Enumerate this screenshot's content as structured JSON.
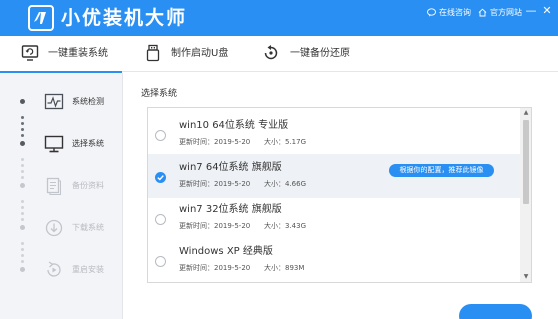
{
  "app": {
    "title": "小优装机大师",
    "logo_icon": "logo-icon",
    "online_consult": "在线咨询",
    "official_site": "官方网站",
    "minimize_glyph": "—",
    "close_glyph": "✕"
  },
  "nav": {
    "tabs": [
      {
        "label": "一键重装系统",
        "icon": "monitor-refresh-icon",
        "active": true
      },
      {
        "label": "制作启动U盘",
        "icon": "usb-drive-icon",
        "active": false
      },
      {
        "label": "一键备份还原",
        "icon": "backup-restore-icon",
        "active": false
      }
    ]
  },
  "sidebar": {
    "steps": [
      {
        "label": "系统检测",
        "icon": "pulse-monitor-icon",
        "state": "done"
      },
      {
        "label": "选择系统",
        "icon": "desktop-icon",
        "state": "current"
      },
      {
        "label": "备份资料",
        "icon": "document-icon",
        "state": "todo"
      },
      {
        "label": "下载系统",
        "icon": "download-icon",
        "state": "todo"
      },
      {
        "label": "重启安装",
        "icon": "restart-icon",
        "state": "todo"
      }
    ]
  },
  "main": {
    "section_title": "选择系统",
    "systems": [
      {
        "name": "win10 64位系统 专业版",
        "update_time": "更新时间：2019-5-20",
        "size": "大小：5.17G",
        "selected": false
      },
      {
        "name": "win7 64位系统 旗舰版",
        "update_time": "更新时间：2019-5-20",
        "size": "大小：4.66G",
        "selected": true,
        "badge": "根据你的配置，推荐此镜像"
      },
      {
        "name": "win7 32位系统 旗舰版",
        "update_time": "更新时间：2019-5-20",
        "size": "大小：3.43G",
        "selected": false
      },
      {
        "name": "Windows XP 经典版",
        "update_time": "更新时间：2019-5-20",
        "size": "大小：893M",
        "selected": false
      }
    ],
    "scroll_up_glyph": "▲",
    "scroll_down_glyph": "▼"
  },
  "colors": {
    "accent": "#2a8ff2",
    "sidebar_bg": "#f3f4f7",
    "selected_row_bg": "#eef1f5"
  }
}
